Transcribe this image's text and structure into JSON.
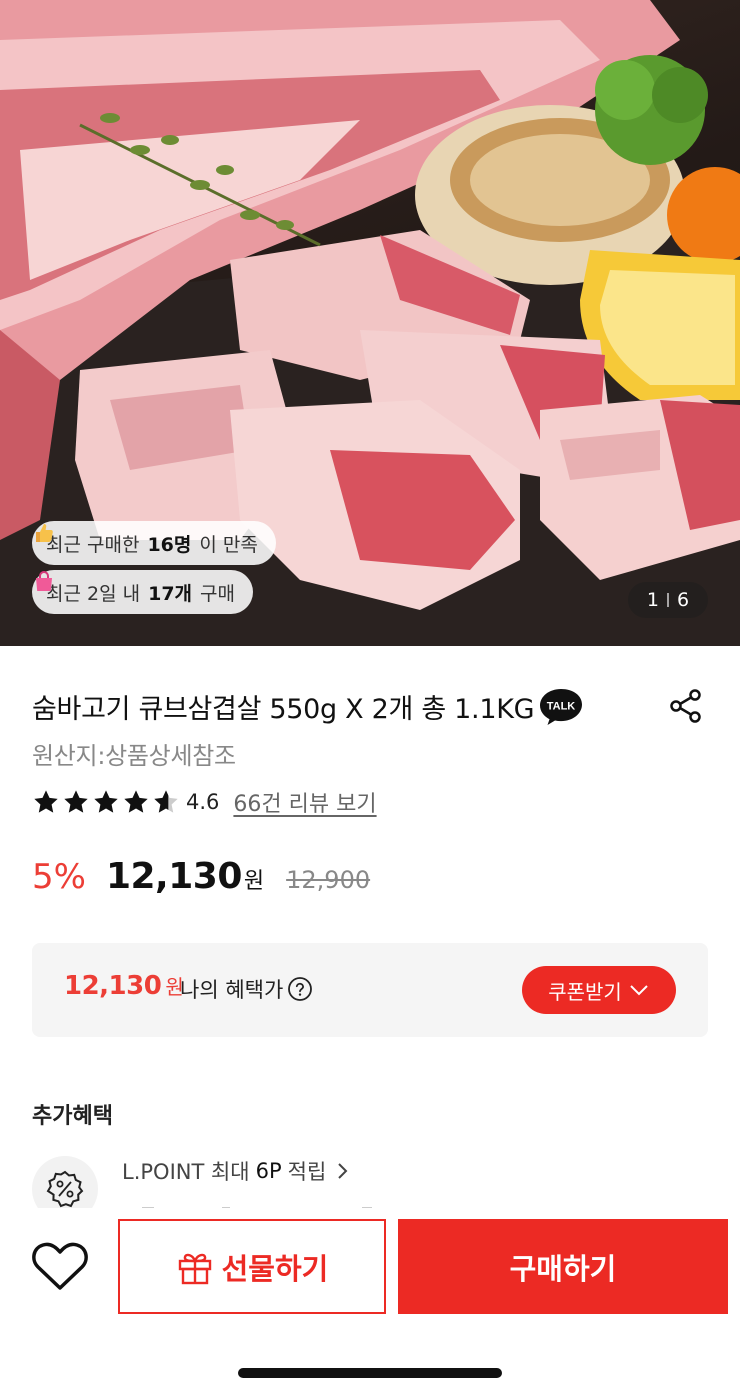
{
  "hero": {
    "satisfaction": {
      "prefix": "최근 구매한 ",
      "count": "16명",
      "suffix": "이 만족",
      "icon": "thumbs-up-icon"
    },
    "recent_sales": {
      "prefix": "최근 2일 내 ",
      "count": "17개",
      "suffix": " 구매",
      "icon": "shopping-bag-icon"
    },
    "image_counter": {
      "current": "1",
      "total": "6"
    }
  },
  "product": {
    "title": "숨바고기 큐브삼겹살 550g X 2개 총 1.1KG",
    "talk_badge": "TALK",
    "origin": "원산지:상품상세참조",
    "rating": 4.6,
    "rating_text": "4.6",
    "review_link": "66건 리뷰 보기",
    "discount": "5%",
    "price": "12,130",
    "price_unit": "원",
    "original_price": "12,900"
  },
  "benefit": {
    "price": "12,130",
    "price_unit": "원",
    "label": "나의 혜택가",
    "coupon_button": "쿠폰받기"
  },
  "extra": {
    "title": "추가혜택",
    "lpoint_prefix": "L.POINT 최대 ",
    "lpoint_amount": "6P",
    "lpoint_suffix": " 적립"
  },
  "bottom": {
    "gift_button": "선물하기",
    "buy_button": "구매하기"
  },
  "colors": {
    "accent": "#ec2a24",
    "discount": "#ec3e36",
    "muted": "#888888",
    "box_bg": "#f5f5f5"
  }
}
